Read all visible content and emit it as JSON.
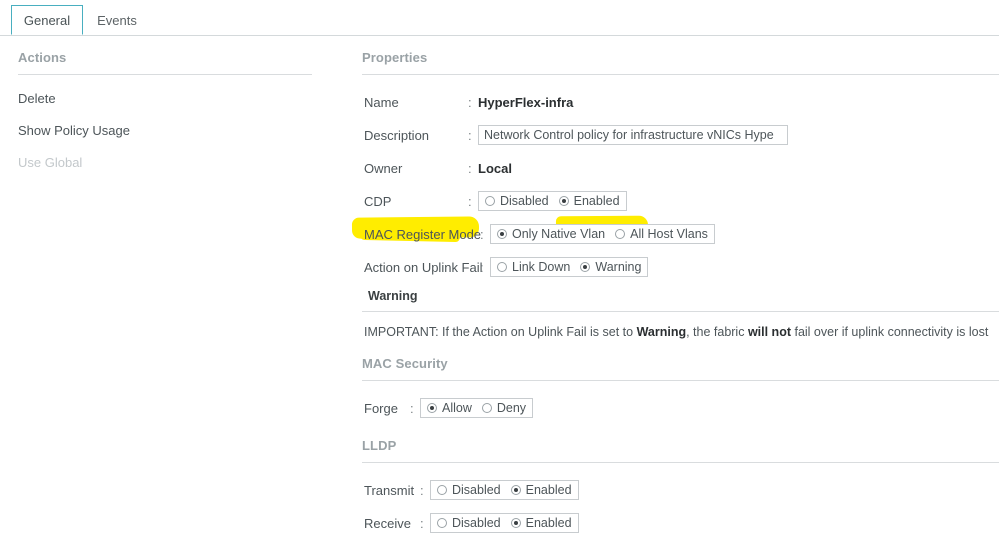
{
  "tabs": [
    {
      "label": "General",
      "active": true
    },
    {
      "label": "Events",
      "active": false
    }
  ],
  "actions": {
    "header": "Actions",
    "items": [
      {
        "label": "Delete",
        "disabled": false
      },
      {
        "label": "Show Policy Usage",
        "disabled": false
      },
      {
        "label": "Use Global",
        "disabled": true
      }
    ]
  },
  "properties": {
    "header": "Properties",
    "name": {
      "label": "Name",
      "colon": ":",
      "value": "HyperFlex-infra"
    },
    "description": {
      "label": "Description",
      "colon": ":",
      "value": "Network Control policy for infrastructure vNICs Hype",
      "placeholder": "Description"
    },
    "owner": {
      "label": "Owner",
      "colon": ":",
      "value": "Local"
    },
    "cdp": {
      "label": "CDP",
      "colon": ":",
      "options": [
        "Disabled",
        "Enabled"
      ],
      "selected": "Enabled"
    },
    "mac_register_mode": {
      "label": "MAC Register Mode",
      "colon": ":",
      "options": [
        "Only Native Vlan",
        "All Host Vlans"
      ],
      "selected": "Only Native Vlan"
    },
    "action_on_uplink_fail": {
      "label": "Action on Uplink Fail",
      "colon": ":",
      "options": [
        "Link Down",
        "Warning"
      ],
      "selected": "Warning",
      "highlighted": true
    }
  },
  "warning_section": {
    "header": "Warning",
    "important_prefix": "IMPORTANT: If the Action on Uplink Fail is set to ",
    "important_bold1": "Warning",
    "important_mid": ", the fabric ",
    "important_bold2": "will not",
    "important_suffix": " fail over if uplink connectivity is lost"
  },
  "mac_security": {
    "header": "MAC Security",
    "forge": {
      "label": "Forge",
      "colon": ":",
      "options": [
        "Allow",
        "Deny"
      ],
      "selected": "Allow"
    }
  },
  "lldp": {
    "header": "LLDP",
    "transmit": {
      "label": "Transmit",
      "colon": ":",
      "options": [
        "Disabled",
        "Enabled"
      ],
      "selected": "Enabled"
    },
    "receive": {
      "label": "Receive",
      "colon": ":",
      "options": [
        "Disabled",
        "Enabled"
      ],
      "selected": "Enabled"
    }
  },
  "colors": {
    "active_tab_border": "#49afc0",
    "highlighter": "#ffed00",
    "text": "#4d5559",
    "muted_header": "#9aa2a6"
  }
}
